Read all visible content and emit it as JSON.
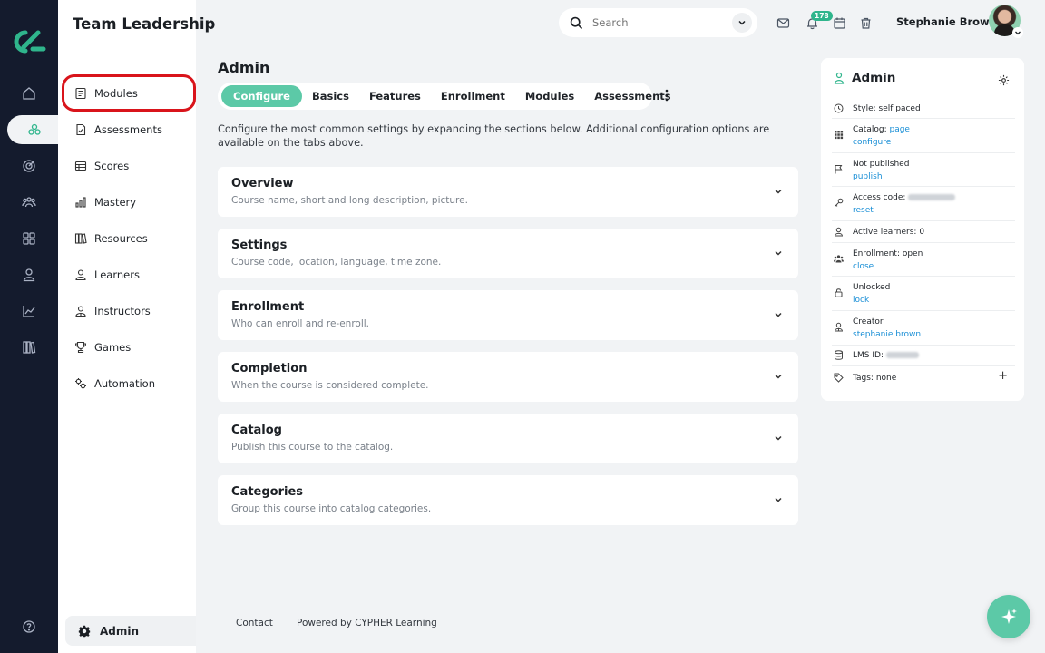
{
  "app": {
    "title": "Team Leadership"
  },
  "rail": {
    "items": [
      "home-icon",
      "course-icon",
      "target-icon",
      "people-icon",
      "apps-icon",
      "user-icon",
      "analytics-icon",
      "library-icon",
      "help-icon"
    ],
    "accent": "#2fb58c"
  },
  "sidebar": {
    "items": [
      {
        "label": "Modules",
        "icon": "modules-icon"
      },
      {
        "label": "Assessments",
        "icon": "assessments-icon"
      },
      {
        "label": "Scores",
        "icon": "scores-icon"
      },
      {
        "label": "Mastery",
        "icon": "mastery-icon"
      },
      {
        "label": "Resources",
        "icon": "resources-icon"
      },
      {
        "label": "Learners",
        "icon": "learners-icon"
      },
      {
        "label": "Instructors",
        "icon": "instructors-icon"
      },
      {
        "label": "Games",
        "icon": "games-icon"
      },
      {
        "label": "Automation",
        "icon": "automation-icon"
      }
    ],
    "footer_label": "Admin",
    "highlight_color": "#d9141b"
  },
  "header": {
    "search_placeholder": "Search",
    "notification_count": "178",
    "user_name": "Stephanie Brown"
  },
  "main": {
    "heading": "Admin",
    "tabs": [
      "Configure",
      "Basics",
      "Features",
      "Enrollment",
      "Modules",
      "Assessments"
    ],
    "active_tab": "Configure",
    "description": "Configure the most common settings by expanding the sections below. Additional configuration options are available on the tabs above.",
    "sections": [
      {
        "title": "Overview",
        "subtitle": "Course name, short and long description, picture."
      },
      {
        "title": "Settings",
        "subtitle": "Course code, location, language, time zone."
      },
      {
        "title": "Enrollment",
        "subtitle": "Who can enroll and re-enroll."
      },
      {
        "title": "Completion",
        "subtitle": "When the course is considered complete."
      },
      {
        "title": "Catalog",
        "subtitle": "Publish this course to the catalog."
      },
      {
        "title": "Categories",
        "subtitle": "Group this course into catalog categories."
      }
    ]
  },
  "footer": {
    "contact": "Contact",
    "powered_by": "Powered by CYPHER Learning"
  },
  "panel": {
    "title": "Admin",
    "style": "Style: self paced",
    "catalog_label": "Catalog:",
    "catalog_page": "page",
    "catalog_configure": "configure",
    "published": "Not published",
    "publish_link": "publish",
    "access_code_label": "Access code:",
    "reset_link": "reset",
    "active_learners": "Active learners: 0",
    "enrollment": "Enrollment: open",
    "close_link": "close",
    "lock_state": "Unlocked",
    "lock_link": "lock",
    "creator_label": "Creator",
    "creator_link": "stephanie brown",
    "lms_id_label": "LMS ID:",
    "tags": "Tags: none",
    "link_color": "#1a8fd6"
  }
}
